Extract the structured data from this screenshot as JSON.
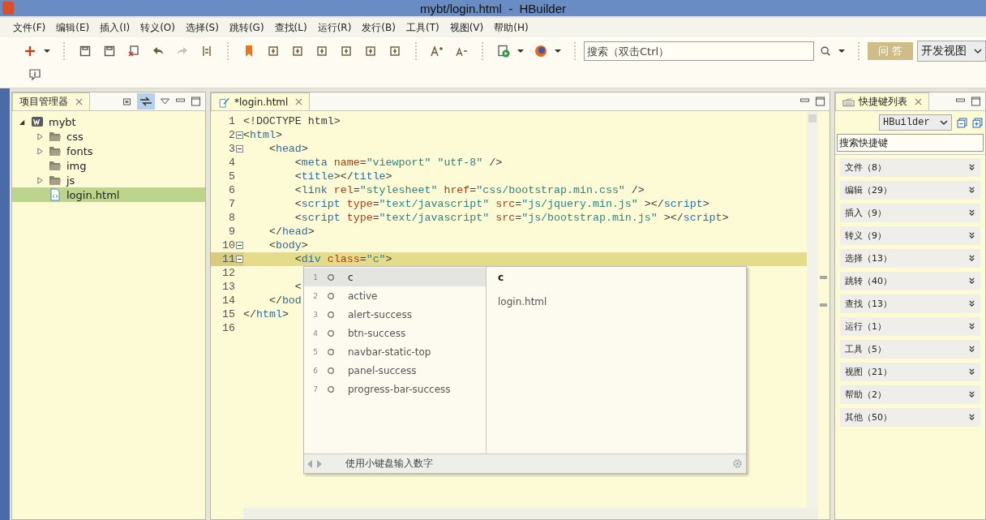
{
  "window": {
    "title": "mybt/login.html  -  HBuilder"
  },
  "menu": [
    "文件(F)",
    "编辑(E)",
    "插入(I)",
    "转义(O)",
    "选择(S)",
    "跳转(G)",
    "查找(L)",
    "运行(R)",
    "发行(B)",
    "工具(T)",
    "视图(V)",
    "帮助(H)"
  ],
  "toolbar": {
    "search": {
      "placeholder": "搜索（双击Ctrl）"
    },
    "qa_button": "问 答",
    "perspective": "开发视图"
  },
  "project_panel": {
    "title": "项目管理器",
    "tree": [
      {
        "label": "mybt",
        "kind": "project",
        "expanded": true,
        "selected": false,
        "children": [
          {
            "label": "css",
            "kind": "folder",
            "expanded": false,
            "selected": false
          },
          {
            "label": "fonts",
            "kind": "folder",
            "expanded": false,
            "selected": false
          },
          {
            "label": "img",
            "kind": "folder",
            "selected": false
          },
          {
            "label": "js",
            "kind": "folder",
            "expanded": false,
            "selected": false
          },
          {
            "label": "login.html",
            "kind": "file",
            "selected": true
          }
        ]
      }
    ]
  },
  "editor": {
    "tab": "*login.html",
    "lines": [
      {
        "n": "1",
        "current": false,
        "fold": false,
        "tokens": [
          {
            "t": "<!DOCTYPE html>",
            "kind": "punct"
          }
        ]
      },
      {
        "n": "2",
        "current": false,
        "fold": true,
        "tokens": [
          {
            "t": "<",
            "kind": "punct"
          },
          {
            "t": "html",
            "kind": "tag"
          },
          {
            "t": ">",
            "kind": "punct"
          }
        ]
      },
      {
        "n": "3",
        "current": false,
        "fold": true,
        "tokens": [
          {
            "t": "    <",
            "kind": "punct"
          },
          {
            "t": "head",
            "kind": "tag"
          },
          {
            "t": ">",
            "kind": "punct"
          }
        ]
      },
      {
        "n": "4",
        "current": false,
        "fold": false,
        "tokens": [
          {
            "t": "        <",
            "kind": "punct"
          },
          {
            "t": "meta",
            "kind": "tag"
          },
          {
            "t": " name",
            "kind": "attr"
          },
          {
            "t": "=",
            "kind": "punct"
          },
          {
            "t": "\"viewport\" \"utf-8\"",
            "kind": "string"
          },
          {
            "t": " />",
            "kind": "punct"
          }
        ]
      },
      {
        "n": "5",
        "current": false,
        "fold": false,
        "tokens": [
          {
            "t": "        <",
            "kind": "punct"
          },
          {
            "t": "title",
            "kind": "tag"
          },
          {
            "t": "></",
            "kind": "punct"
          },
          {
            "t": "title",
            "kind": "tag"
          },
          {
            "t": ">",
            "kind": "punct"
          }
        ]
      },
      {
        "n": "6",
        "current": false,
        "fold": false,
        "tokens": [
          {
            "t": "        <",
            "kind": "punct"
          },
          {
            "t": "link",
            "kind": "tag"
          },
          {
            "t": " rel",
            "kind": "attr"
          },
          {
            "t": "=",
            "kind": "punct"
          },
          {
            "t": "\"stylesheet\"",
            "kind": "string"
          },
          {
            "t": " href",
            "kind": "attr"
          },
          {
            "t": "=",
            "kind": "punct"
          },
          {
            "t": "\"css/bootstrap.min.css\"",
            "kind": "string"
          },
          {
            "t": " />",
            "kind": "punct"
          }
        ]
      },
      {
        "n": "7",
        "current": false,
        "fold": false,
        "tokens": [
          {
            "t": "        <",
            "kind": "punct"
          },
          {
            "t": "script",
            "kind": "tag"
          },
          {
            "t": " type",
            "kind": "attr"
          },
          {
            "t": "=",
            "kind": "punct"
          },
          {
            "t": "\"text/javascript\"",
            "kind": "string"
          },
          {
            "t": " src",
            "kind": "attr"
          },
          {
            "t": "=",
            "kind": "punct"
          },
          {
            "t": "\"js/jquery.min.js\"",
            "kind": "string"
          },
          {
            "t": " ></",
            "kind": "punct"
          },
          {
            "t": "script",
            "kind": "tag"
          },
          {
            "t": ">",
            "kind": "punct"
          }
        ]
      },
      {
        "n": "8",
        "current": false,
        "fold": false,
        "tokens": [
          {
            "t": "        <",
            "kind": "punct"
          },
          {
            "t": "script",
            "kind": "tag"
          },
          {
            "t": " type",
            "kind": "attr"
          },
          {
            "t": "=",
            "kind": "punct"
          },
          {
            "t": "\"text/javascript\"",
            "kind": "string"
          },
          {
            "t": " src",
            "kind": "attr"
          },
          {
            "t": "=",
            "kind": "punct"
          },
          {
            "t": "\"js/bootstrap.min.js\"",
            "kind": "string"
          },
          {
            "t": " ></",
            "kind": "punct"
          },
          {
            "t": "script",
            "kind": "tag"
          },
          {
            "t": ">",
            "kind": "punct"
          }
        ]
      },
      {
        "n": "9",
        "current": false,
        "fold": false,
        "tokens": [
          {
            "t": "    </",
            "kind": "punct"
          },
          {
            "t": "head",
            "kind": "tag"
          },
          {
            "t": ">",
            "kind": "punct"
          }
        ]
      },
      {
        "n": "10",
        "current": false,
        "fold": true,
        "tokens": [
          {
            "t": "    <",
            "kind": "punct"
          },
          {
            "t": "body",
            "kind": "tag"
          },
          {
            "t": ">",
            "kind": "punct"
          }
        ]
      },
      {
        "n": "11",
        "current": true,
        "fold": true,
        "tokens": [
          {
            "t": "        <",
            "kind": "punct"
          },
          {
            "t": "div",
            "kind": "tag"
          },
          {
            "t": " class",
            "kind": "attr"
          },
          {
            "t": "=",
            "kind": "punct"
          },
          {
            "t": "\"c\"",
            "kind": "string"
          },
          {
            "t": ">",
            "kind": "punct"
          }
        ]
      },
      {
        "n": "12",
        "current": false,
        "fold": false
      },
      {
        "n": "13",
        "current": false,
        "fold": false,
        "tokens": [
          {
            "t": "        <",
            "kind": "punct"
          }
        ]
      },
      {
        "n": "14",
        "current": false,
        "fold": false,
        "tokens": [
          {
            "t": "    </",
            "kind": "punct"
          },
          {
            "t": "bod",
            "kind": "tag"
          }
        ]
      },
      {
        "n": "15",
        "current": false,
        "fold": false,
        "tokens": [
          {
            "t": "</",
            "kind": "punct"
          },
          {
            "t": "html",
            "kind": "tag"
          },
          {
            "t": ">",
            "kind": "punct"
          }
        ]
      },
      {
        "n": "16",
        "current": false,
        "fold": false
      }
    ],
    "completion": {
      "items": [
        {
          "index": "1",
          "label": "c",
          "selected": true
        },
        {
          "index": "2",
          "label": "active",
          "selected": false
        },
        {
          "index": "3",
          "label": "alert-success",
          "selected": false
        },
        {
          "index": "4",
          "label": "btn-success",
          "selected": false
        },
        {
          "index": "5",
          "label": "navbar-static-top",
          "selected": false
        },
        {
          "index": "6",
          "label": "panel-success",
          "selected": false
        },
        {
          "index": "7",
          "label": "progress-bar-success",
          "selected": false
        }
      ],
      "detail": [
        "c",
        "login.html"
      ],
      "hint": "使用小键盘输入数字"
    }
  },
  "shortcut_panel": {
    "title": "快捷键列表",
    "scheme": "HBuilder",
    "search": {
      "placeholder": "搜索快捷键"
    },
    "categories": [
      "文件（8）",
      "编辑（29）",
      "插入（9）",
      "转义（9）",
      "选择（13）",
      "跳转（40）",
      "查找（13）",
      "运行（1）",
      "工具（5）",
      "视图（21）",
      "帮助（2）",
      "其他（50）"
    ]
  }
}
